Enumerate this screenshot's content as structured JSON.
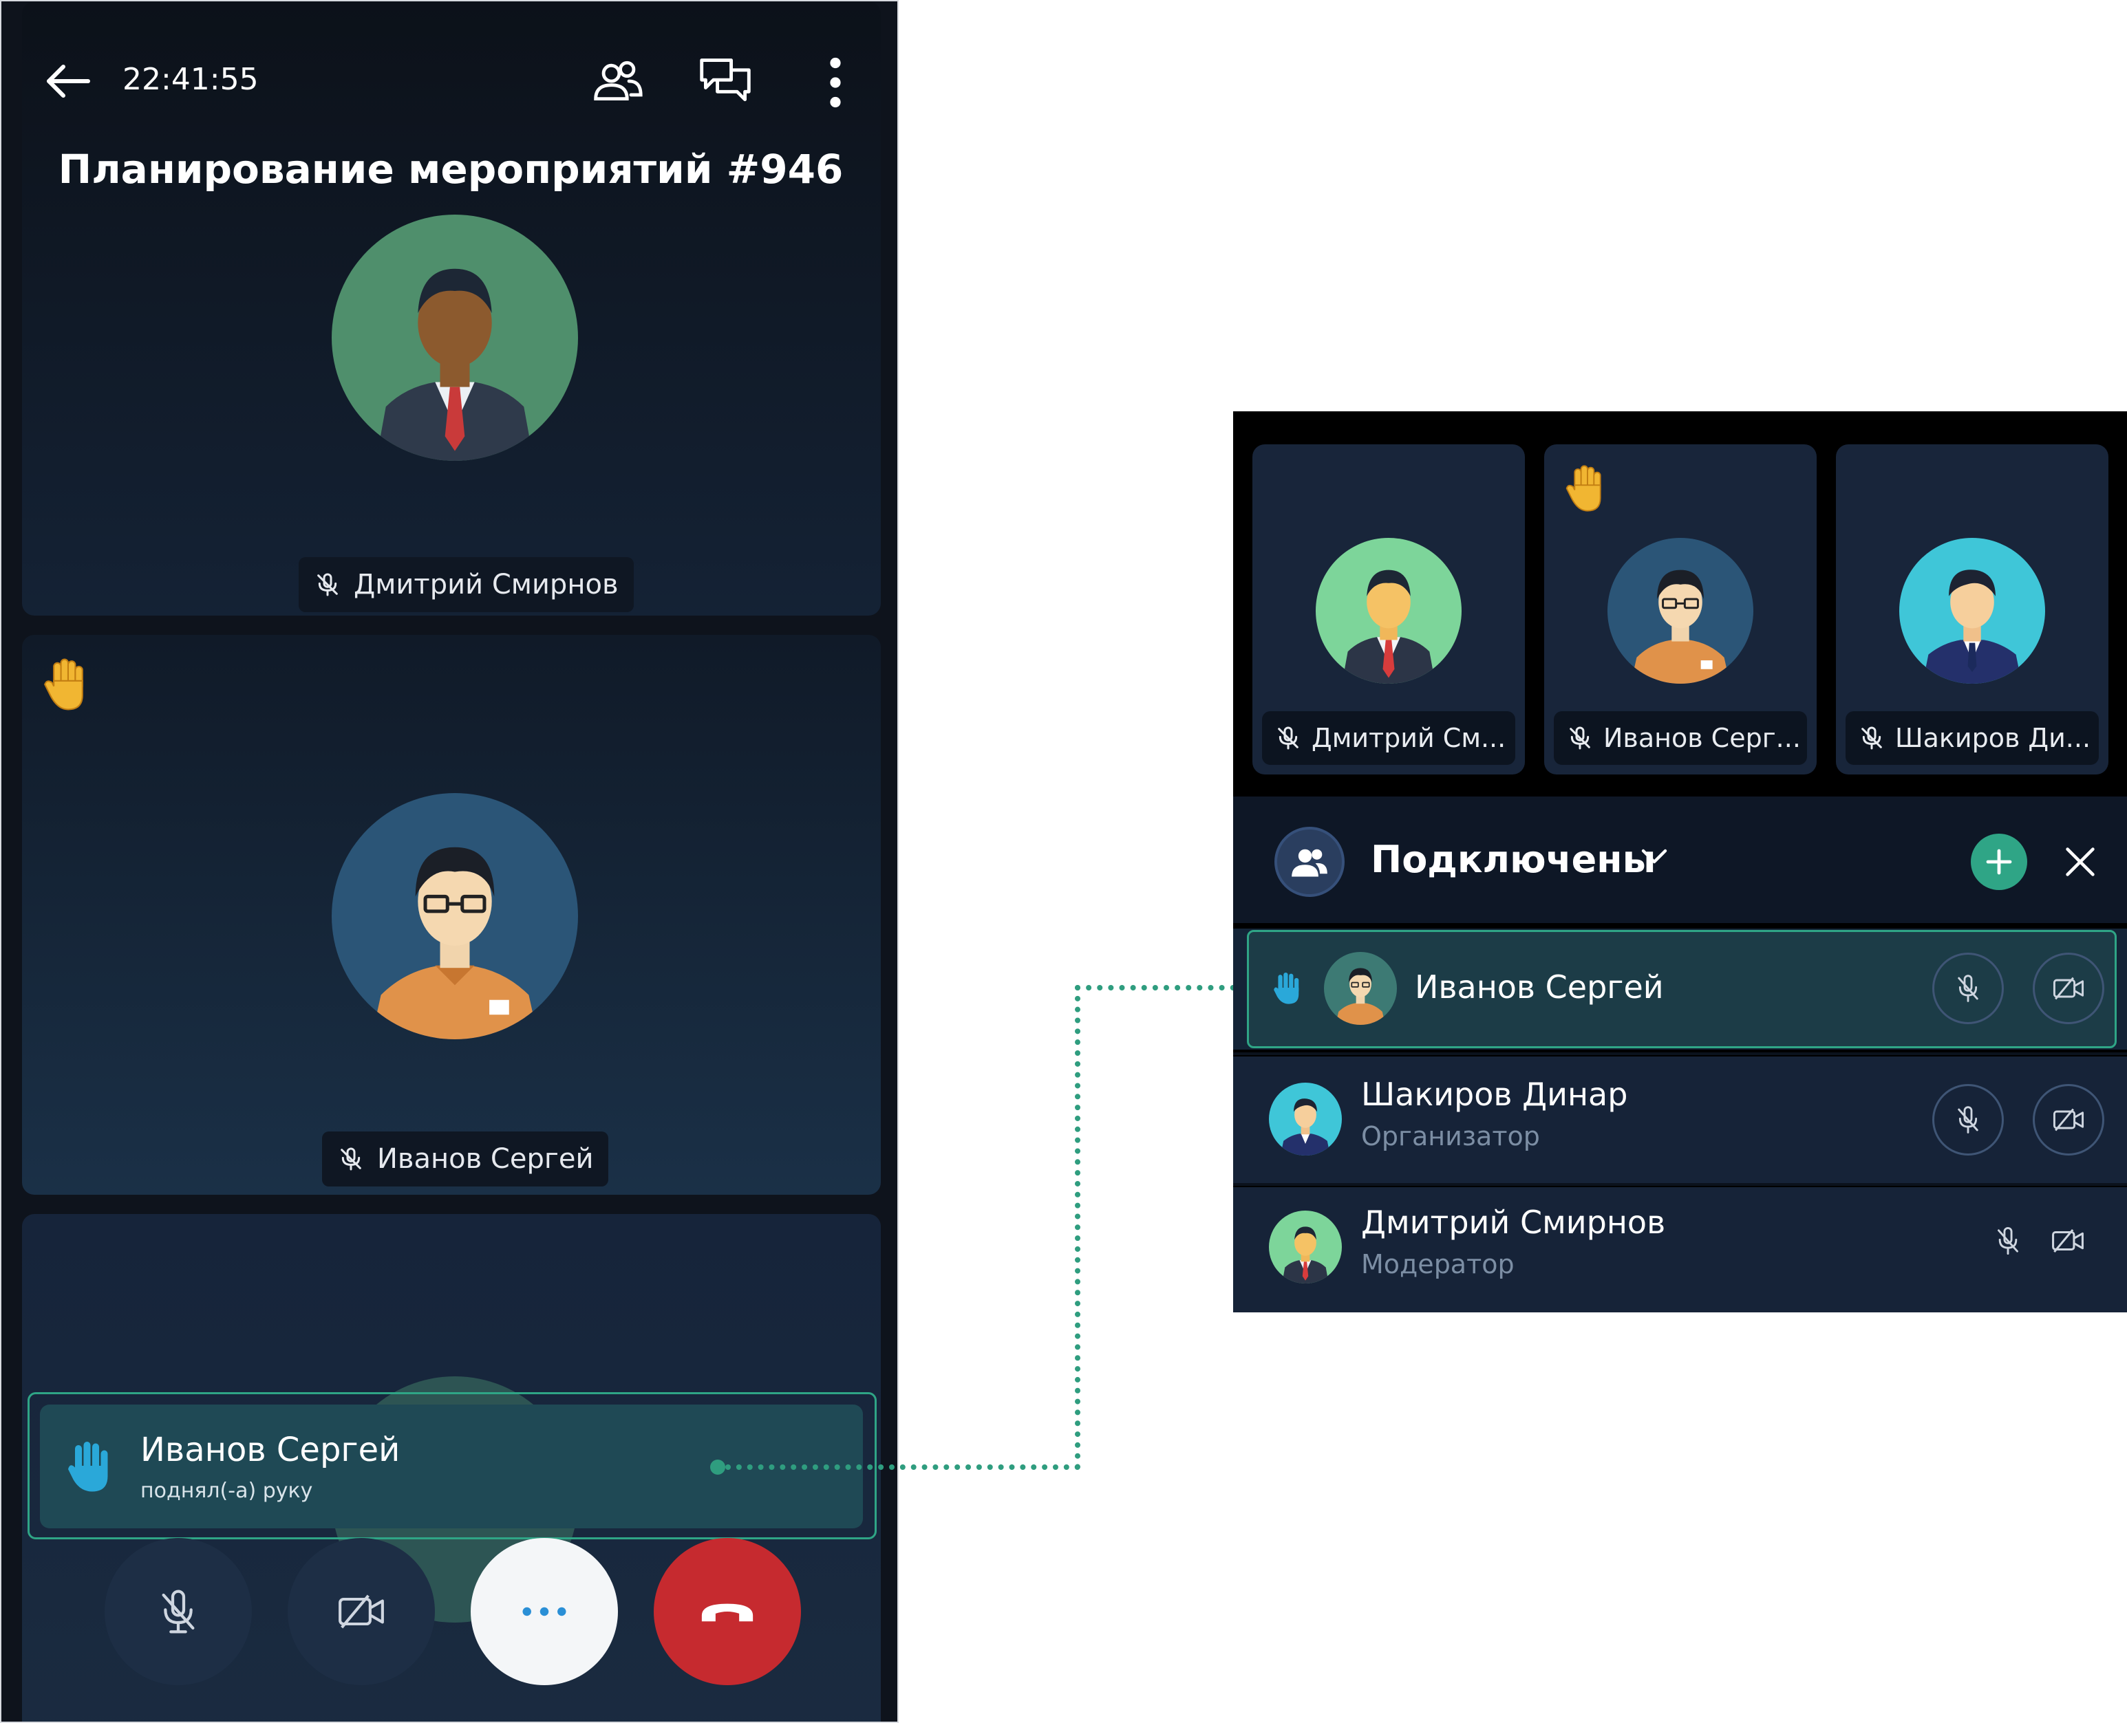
{
  "phone": {
    "time": "22:41:55",
    "meeting_title": "Планирование мероприятий #946",
    "tiles": [
      {
        "name": "Дмитрий Смирнов",
        "hand_raised": false
      },
      {
        "name": "Иванов Сергей",
        "hand_raised": true
      }
    ],
    "notification": {
      "name": "Иванов Сергей",
      "text": "поднял(-а) руку"
    },
    "icons": {
      "back": "arrow-left-icon",
      "participants": "participants-icon",
      "chat": "chat-icon",
      "more": "more-vertical-icon"
    }
  },
  "panel": {
    "tiles": [
      {
        "name": "Дмитрий См..."
      },
      {
        "name": "Иванов Серг..."
      },
      {
        "name": "Шакиров Ди..."
      }
    ],
    "header": {
      "title": "Подключены"
    },
    "participants": [
      {
        "name": "Иванов Сергей",
        "role": "",
        "hand_raised": true
      },
      {
        "name": "Шакиров Динар",
        "role": "Организатор",
        "hand_raised": false
      },
      {
        "name": "Дмитрий Смирнов",
        "role": "Модератор",
        "hand_raised": false
      }
    ]
  },
  "colors": {
    "accent": "#2fa586",
    "end_call": "#c62a2f",
    "background": "#0e131c"
  }
}
